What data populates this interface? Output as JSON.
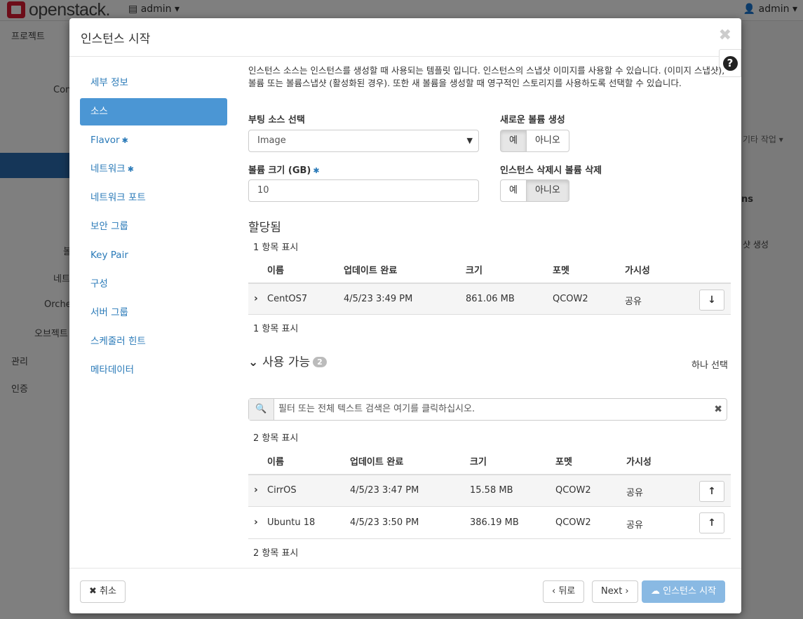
{
  "topbar": {
    "brand": "openstack.",
    "project": "admin ▾",
    "user": "admin ▾"
  },
  "background": {
    "side_labels": [
      "프로젝트",
      "Con",
      "볼",
      "네트",
      "Orche",
      "오브젝트",
      "관리",
      "인증"
    ],
    "right_labels": [
      "기타 작업 ▾",
      "ns",
      "샷 생성"
    ]
  },
  "modal": {
    "title": "인스턴스 시작",
    "close": "✖",
    "help": "?",
    "nav": [
      {
        "label": "세부 정보",
        "required": false
      },
      {
        "label": "소스",
        "required": false,
        "active": true
      },
      {
        "label": "Flavor",
        "required": true
      },
      {
        "label": "네트워크",
        "required": true
      },
      {
        "label": "네트워크 포트",
        "required": false
      },
      {
        "label": "보안 그룹",
        "required": false
      },
      {
        "label": "Key Pair",
        "required": false
      },
      {
        "label": "구성",
        "required": false
      },
      {
        "label": "서버 그룹",
        "required": false
      },
      {
        "label": "스케줄러 힌트",
        "required": false
      },
      {
        "label": "메타데이터",
        "required": false
      }
    ],
    "required_mark": "✱",
    "description": "인스턴스 소스는 인스턴스를 생성할 때 사용되는 템플릿 입니다. 인스턴스의 스냅샷 이미지를 사용할 수 있습니다. (이미지 스냅샷), 볼륨 또는 볼륨스냅샷 (활성화된 경우). 또한 새 볼륨을 생성할 때 영구적인 스토리지를 사용하도록 선택할 수 있습니다.",
    "boot_source": {
      "label": "부팅 소스 선택",
      "value": "Image"
    },
    "new_volume": {
      "label": "새로운 볼륨 생성",
      "yes": "예",
      "no": "아니오",
      "selected": "yes"
    },
    "volume_size": {
      "label": "볼륨 크기 (GB)",
      "value": "10"
    },
    "delete_volume": {
      "label": "인스턴스 삭제시 볼륨 삭제",
      "yes": "예",
      "no": "아니오",
      "selected": "no"
    },
    "allocated": {
      "title": "할당됨",
      "count_top": "1 항목 표시",
      "count_bottom": "1 항목 표시",
      "headers": [
        "이름",
        "업데이트 완료",
        "크기",
        "포멧",
        "가시성"
      ],
      "rows": [
        {
          "name": "CentOS7",
          "updated": "4/5/23 3:49 PM",
          "size": "861.06 MB",
          "format": "QCOW2",
          "visibility": "공유"
        }
      ]
    },
    "available": {
      "title": "사용 가능",
      "badge": "2",
      "select_one": "하나 선택",
      "filter_placeholder": "필터 또는 전체 텍스트 검색은 여기를 클릭하십시오.",
      "count_top": "2 항목 표시",
      "count_bottom": "2 항목 표시",
      "headers": [
        "이름",
        "업데이트 완료",
        "크기",
        "포멧",
        "가시성"
      ],
      "rows": [
        {
          "name": "CirrOS",
          "updated": "4/5/23 3:47 PM",
          "size": "15.58 MB",
          "format": "QCOW2",
          "visibility": "공유"
        },
        {
          "name": "Ubuntu 18",
          "updated": "4/5/23 3:50 PM",
          "size": "386.19 MB",
          "format": "QCOW2",
          "visibility": "공유"
        }
      ]
    },
    "footer": {
      "cancel": "취소",
      "back": "‹ 뒤로",
      "next": "Next ›",
      "launch": "인스턴스 시작"
    }
  }
}
